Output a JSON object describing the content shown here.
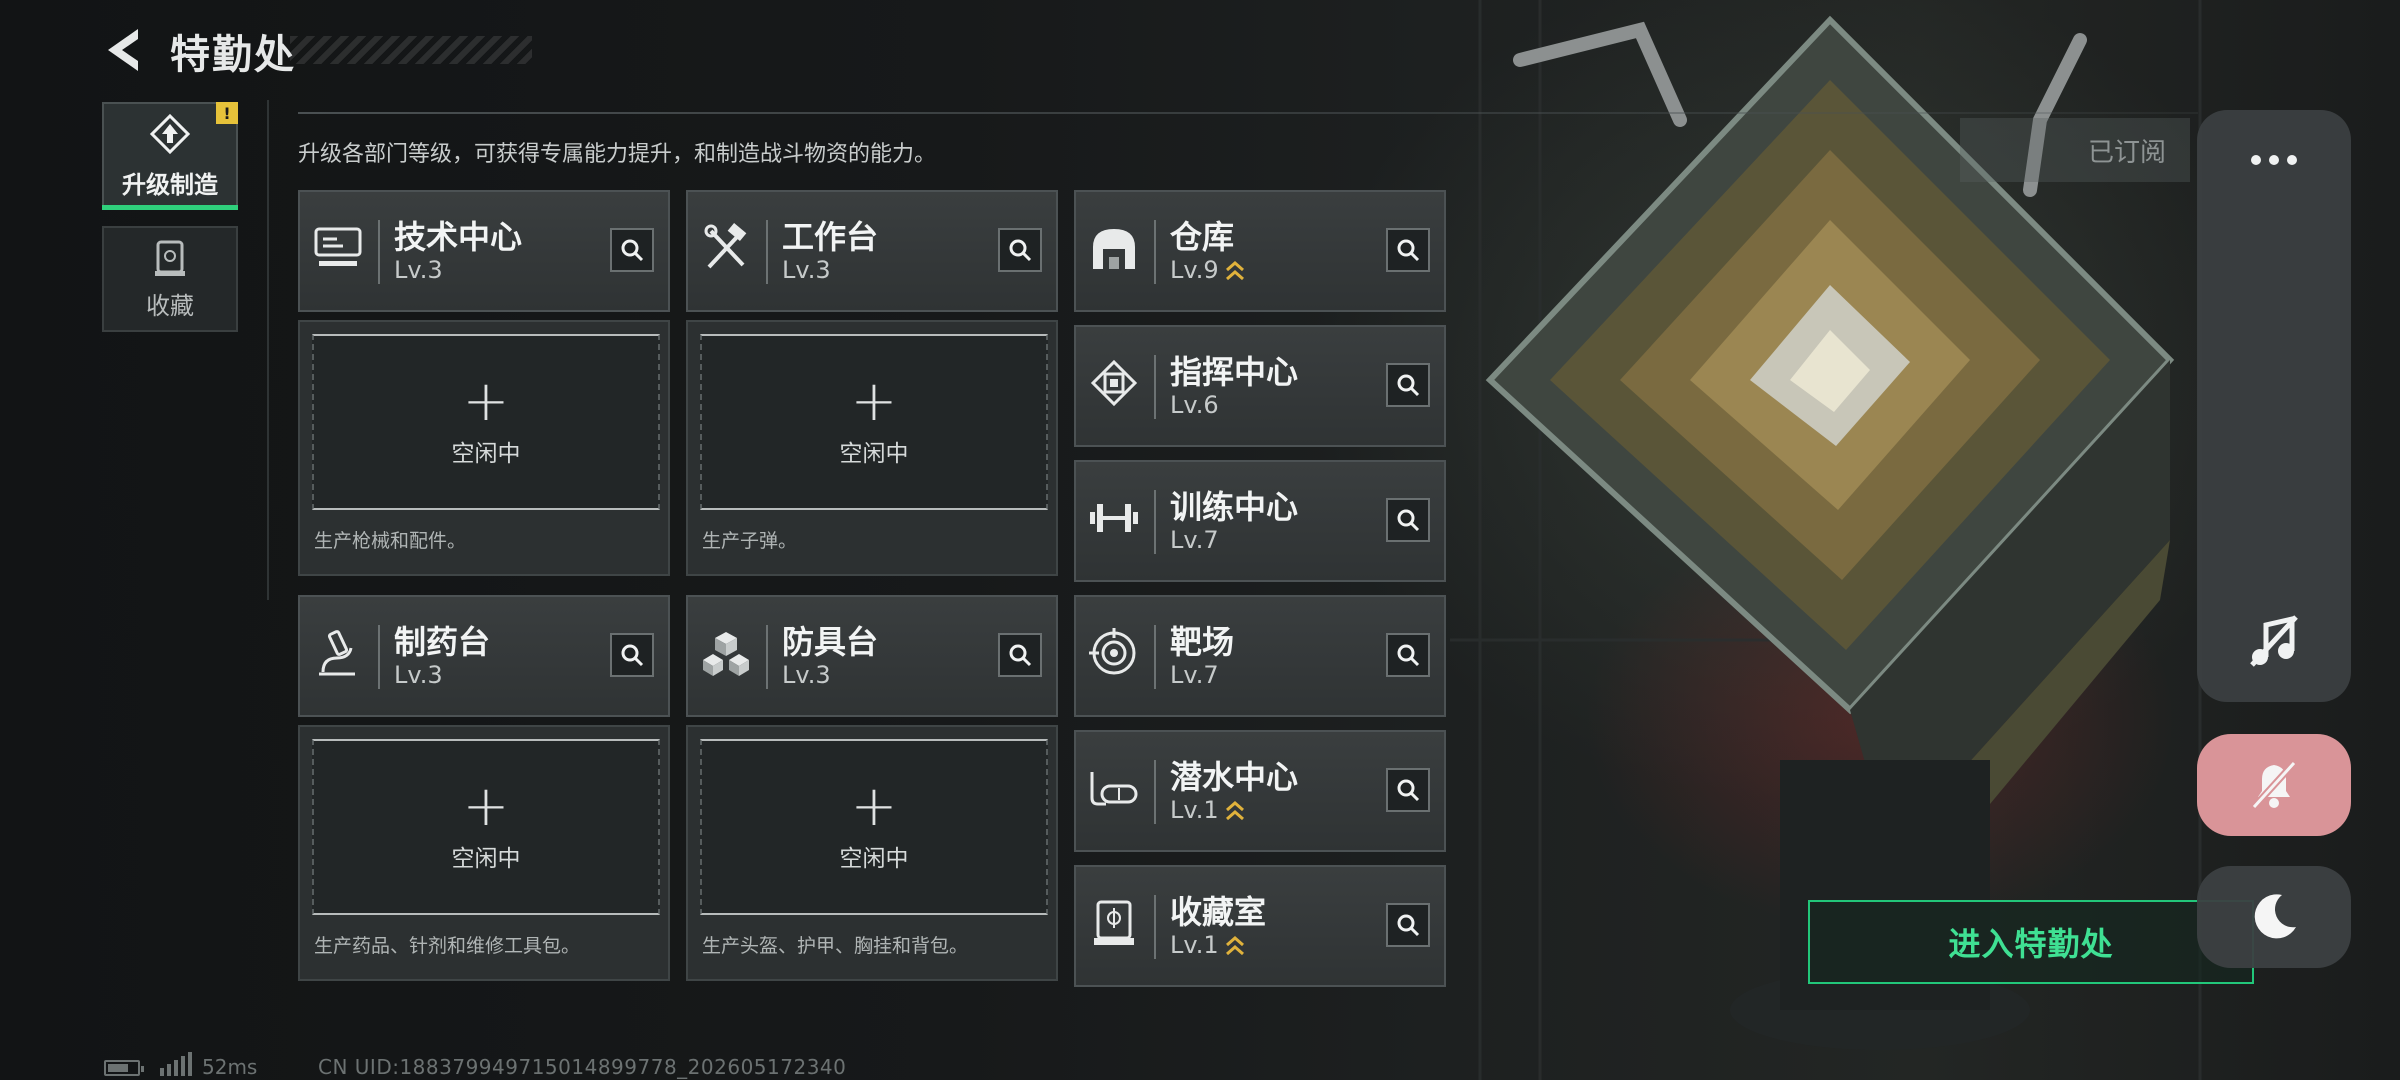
{
  "header": {
    "title": "特勤处"
  },
  "side_tabs": [
    {
      "label": "升级制造",
      "active": true,
      "badge": "!"
    },
    {
      "label": "收藏",
      "active": false
    }
  ],
  "description": "升级各部门等级，可获得专属能力提升，和制造战斗物资的能力。",
  "departments": {
    "tech_center": {
      "name": "技术中心",
      "level": "Lv.3",
      "icon": "workstation-monitor-icon"
    },
    "workbench": {
      "name": "工作台",
      "level": "Lv.3",
      "icon": "hammer-wrench-icon"
    },
    "warehouse": {
      "name": "仓库",
      "level": "Lv.9",
      "icon": "hangar-icon",
      "upgradable": true
    },
    "command_center": {
      "name": "指挥中心",
      "level": "Lv.6",
      "icon": "chip-icon"
    },
    "training_center": {
      "name": "训练中心",
      "level": "Lv.7",
      "icon": "dumbbell-icon"
    },
    "pharmacy": {
      "name": "制药台",
      "level": "Lv.3",
      "icon": "microscope-icon"
    },
    "armor_bench": {
      "name": "防具台",
      "level": "Lv.3",
      "icon": "cubes-icon"
    },
    "shooting_range": {
      "name": "靶场",
      "level": "Lv.7",
      "icon": "target-icon"
    },
    "dive_center": {
      "name": "潜水中心",
      "level": "Lv.1",
      "icon": "diving-mask-icon",
      "upgradable": true
    },
    "collection_room": {
      "name": "收藏室",
      "level": "Lv.1",
      "icon": "display-case-icon",
      "upgradable": true
    }
  },
  "production": {
    "plus": "+",
    "idle_label": "空闲中",
    "tech_center_desc": "生产枪械和配件。",
    "workbench_desc": "生产子弹。",
    "pharmacy_desc": "生产药品、针剂和维修工具包。",
    "armor_bench_desc": "生产头盔、护甲、胸挂和背包。"
  },
  "subscribed_label": "已订阅",
  "enter_button": "进入特勤处",
  "right_menu": {
    "more": "more-dots-icon",
    "music": "music-off-icon",
    "bell": "bell-muted-icon",
    "moon": "moon-icon"
  },
  "footer": {
    "ping": "52ms",
    "uid": "CN UID:18837994971501489977​8_202605172340"
  },
  "colors": {
    "accent_green": "#2fd07c",
    "warning_yellow": "#e6c23a",
    "upgrade_gold": "#e0b23c",
    "bell_pink": "#d99498"
  }
}
